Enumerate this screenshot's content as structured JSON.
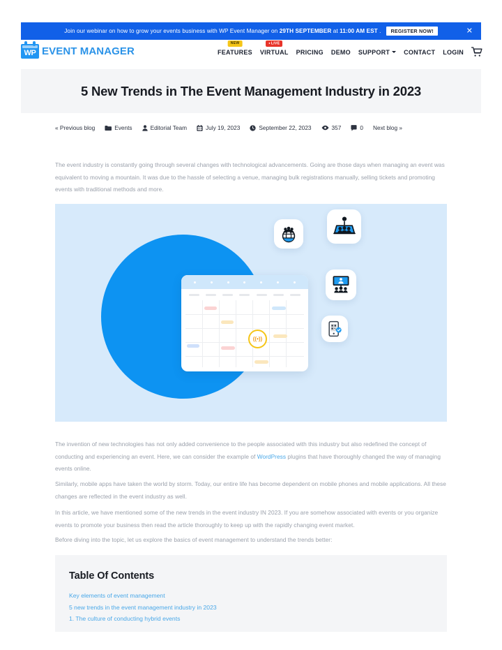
{
  "announcement": {
    "text_before": "Join our webinar on how to grow your events business with WP Event Manager on ",
    "date": "29TH SEPTEMBER",
    "text_mid": " at ",
    "time": "11:00 AM EST",
    "text_after": " .",
    "button_label": "REGISTER NOW!",
    "close_icon": "close-icon",
    "bg_color": "#1160e8"
  },
  "header": {
    "logo": {
      "mark_text": "WP",
      "text": "EVENT MANAGER",
      "color": "#2b93e8"
    },
    "nav": [
      {
        "label": "FEATURES",
        "badge": "NEW",
        "badge_type": "new"
      },
      {
        "label": "VIRTUAL",
        "badge": "LIVE",
        "badge_type": "live"
      },
      {
        "label": "PRICING",
        "badge": null
      },
      {
        "label": "DEMO",
        "badge": null
      },
      {
        "label": "SUPPORT",
        "badge": null,
        "has_chevron": true
      },
      {
        "label": "CONTACT",
        "badge": null
      },
      {
        "label": "LOGIN",
        "badge": null
      }
    ],
    "cart_icon": "shopping-cart-icon"
  },
  "article": {
    "title": "5 New Trends in The Event Management Industry in 2023",
    "meta": {
      "previous_blog": "« Previous blog",
      "category": "Events",
      "author": "Editorial Team",
      "published_date": "July 19, 2023",
      "updated_date": "September 22, 2023",
      "views": "357",
      "comments": "0",
      "next_blog": "Next blog »"
    },
    "paragraphs": {
      "intro": "The event industry is constantly going through several changes with technological advancements. Going are those days when managing an event was equivalent to moving a mountain. It was due to the hassle of selecting a venue, managing bulk registrations manually, selling tickets and promoting events with traditional methods and more.",
      "p2_before": "The invention of new technologies has not only added convenience to the people associated with this industry but also redefined the concept of conducting and experiencing an event. Here, we can consider the example of ",
      "p2_link": "WordPress",
      "p2_after": " plugins that have thoroughly changed the way of managing events online.",
      "p3": "Similarly, mobile apps have taken the world by storm. Today, our entire life has become dependent on mobile phones and mobile applications. All these changes are reflected in the event industry as well.",
      "p4": "In this article, we have mentioned some of the new trends in the event industry IN 2023. If you are somehow associated with events or you organize events to promote your business then read the article thoroughly to keep up with the rapidly changing event market.",
      "p5": "Before diving into the topic, let us explore the basics of event management to understand the trends better:"
    },
    "hero_image": {
      "alt": "event calendar illustration with floating feature icons",
      "bg_color": "#d7eafb",
      "circle_color": "#0d93f2",
      "icons": [
        "globe-people-icon",
        "stage-presentation-icon",
        "video-conference-icon",
        "mobile-ticket-icon"
      ],
      "badge_icon": "live-broadcast-icon"
    }
  },
  "toc": {
    "title": "Table Of Contents",
    "links": [
      "Key elements of event management",
      "5 new trends in the event management industry in 2023",
      "1. The culture of conducting hybrid events"
    ]
  }
}
